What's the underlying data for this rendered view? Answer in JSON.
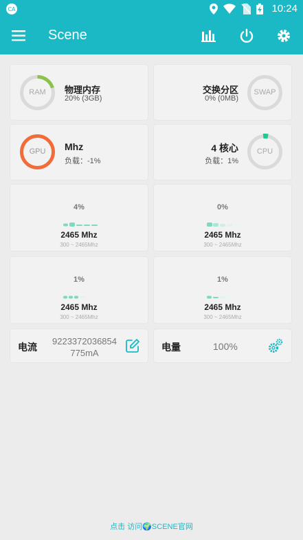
{
  "status": {
    "time": "10:24"
  },
  "app": {
    "title": "Scene"
  },
  "ram": {
    "ring_label": "RAM",
    "name": "物理内存",
    "value": "20% (3GB)",
    "usage": 0.2
  },
  "swap": {
    "ring_label": "SWAP",
    "name": "交换分区",
    "value": "0% (0MB)",
    "usage": 0
  },
  "gpu": {
    "ring_label": "GPU",
    "name": "Mhz",
    "load": "负载：-1%"
  },
  "cpu": {
    "ring_label": "CPU",
    "name": "4 核心",
    "load": "负载：1%",
    "usage": 0.01
  },
  "cores": [
    {
      "percent": "4%",
      "freq": "2465 Mhz",
      "range": "300 ~ 2465Mhz"
    },
    {
      "percent": "0%",
      "freq": "2465 Mhz",
      "range": "300 ~ 2465Mhz"
    },
    {
      "percent": "1%",
      "freq": "2465 Mhz",
      "range": "300 ~ 2465Mhz"
    },
    {
      "percent": "1%",
      "freq": "2465 Mhz",
      "range": "300 ~ 2465Mhz"
    }
  ],
  "current": {
    "label": "电流",
    "value_line1": "9223372036854",
    "value_line2": "775mA"
  },
  "battery": {
    "label": "电量",
    "value": "100%"
  },
  "footer": {
    "text": "点击 访问🌍SCENE官网"
  },
  "colors": {
    "accent": "#1bb8c6",
    "ring_green": "#8bc34a",
    "ring_gpu": "#f26b3a",
    "bar": "#7ed9c0"
  }
}
